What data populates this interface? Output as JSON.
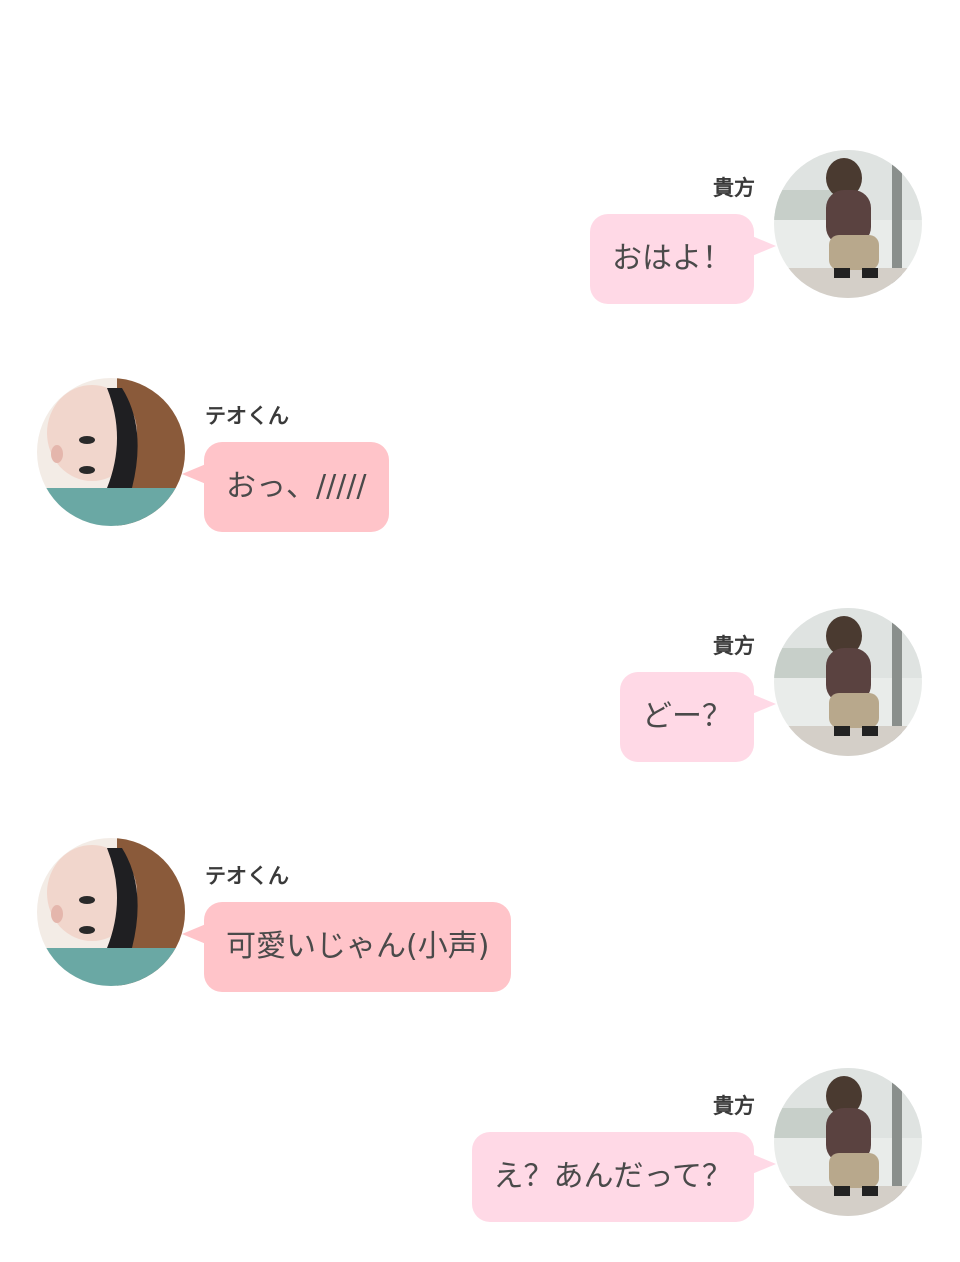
{
  "colors": {
    "bubble_self": "#ffd9e6",
    "bubble_other": "#ffc4c9",
    "text": "#4a4a4a",
    "name": "#3a3a3a"
  },
  "messages": [
    {
      "sender": "貴方",
      "side": "right",
      "text": "おはよ！"
    },
    {
      "sender": "テオくん",
      "side": "left",
      "text": "おっ、/////"
    },
    {
      "sender": "貴方",
      "side": "right",
      "text": "どー？"
    },
    {
      "sender": "テオくん",
      "side": "left",
      "text": "可愛いじゃん(小声)"
    },
    {
      "sender": "貴方",
      "side": "right",
      "text": "え？あんだって？"
    }
  ]
}
